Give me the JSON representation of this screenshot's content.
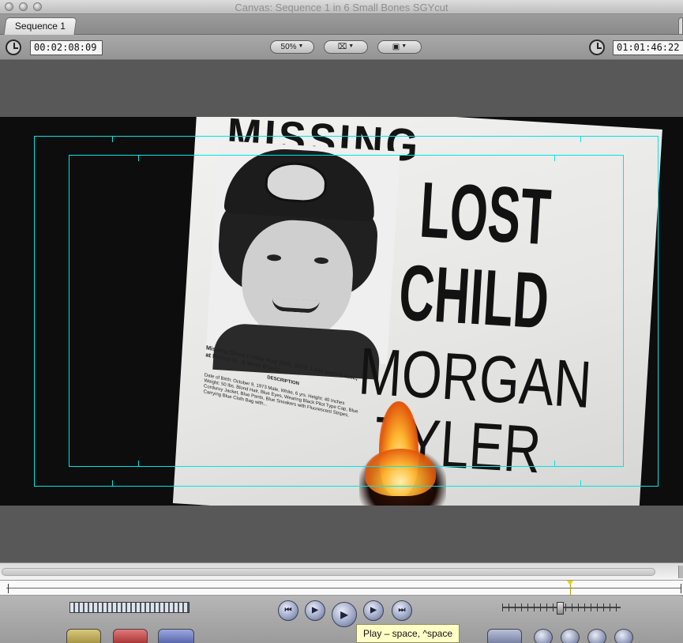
{
  "window": {
    "title": "Canvas: Sequence 1 in 6 Small Bones SGYcut"
  },
  "tabs": [
    {
      "label": "Sequence 1"
    }
  ],
  "toolbar": {
    "current_timecode": "00:02:08:09",
    "zoom_value": "50%",
    "view_menu_label": "⌧",
    "overlay_menu_label": "▣",
    "duration_timecode": "01:01:46:22"
  },
  "frame_content": {
    "poster_headline_top": "MISSING",
    "poster_line_1": "LOST",
    "poster_line_2": "CHILD",
    "poster_line_3": "MORGAN",
    "poster_line_4": "TYLER",
    "poster_caption": "Missing Since Friday May 25th, 1979. Last seen 8 a.m., at Prince St. & West B'way.",
    "poster_description_heading": "DESCRIPTION",
    "poster_description": "Date of Birth: October 9, 1973   Male, White, 6 yrs. Height: 40 Inches   Weight: 50 lbs. Blond Hair, Blue Eyes, Wearing Black Pilot Type Cap, Blue Corduroy Jacket, Blue Pants, Blue Sneakers with Fluorescent Stripes, Carrying Blue Cloth Bag with..."
  },
  "timeline": {
    "playhead_position_fraction": 0.835
  },
  "transport": {
    "buttons": [
      {
        "name": "go-to-previous-edit",
        "glyph": "⏮"
      },
      {
        "name": "play-in-to-out",
        "glyph": "▶"
      },
      {
        "name": "play",
        "glyph": "▶"
      },
      {
        "name": "play-around-current-frame",
        "glyph": "▶"
      },
      {
        "name": "go-to-next-edit",
        "glyph": "⏭"
      }
    ]
  },
  "tooltip": {
    "text": "Play – space, ^space"
  },
  "colors": {
    "safe_area": "#00e5e5",
    "playhead": "#e5d200",
    "tooltip_bg": "#ffffc6"
  }
}
